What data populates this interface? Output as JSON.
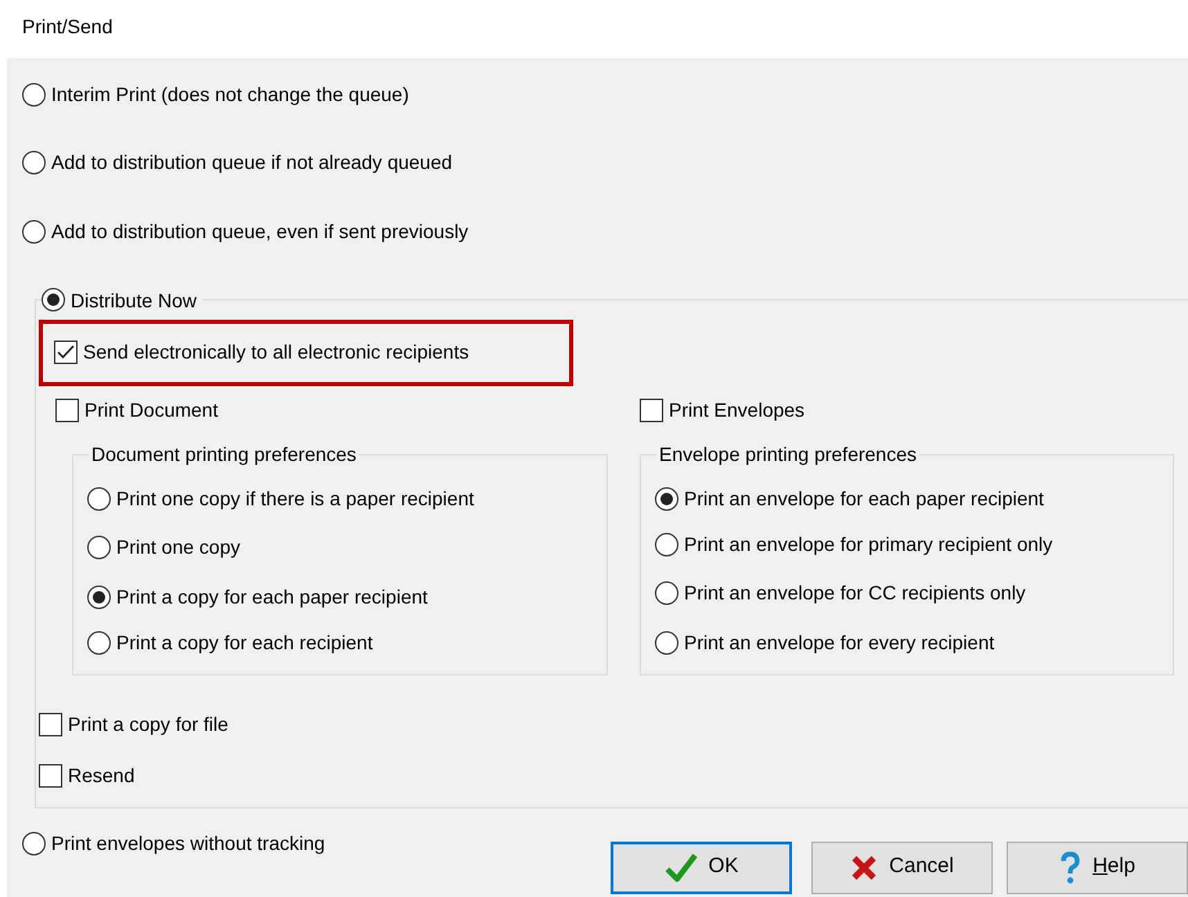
{
  "title": "Print/Send",
  "modes": [
    {
      "label": "Interim Print (does not change the queue)",
      "selected": false
    },
    {
      "label": "Add to distribution queue if not already queued",
      "selected": false
    },
    {
      "label": "Add to distribution queue, even if sent previously",
      "selected": false
    },
    {
      "label": "Distribute Now",
      "selected": true
    }
  ],
  "distribute": {
    "send_electronically": {
      "label": "Send electronically to all electronic recipients",
      "checked": true,
      "highlighted": true
    },
    "print_document": {
      "label": "Print Document",
      "checked": false
    },
    "print_envelopes": {
      "label": "Print Envelopes",
      "checked": false
    },
    "document_preferences": {
      "title": "Document printing preferences",
      "options": [
        {
          "label": "Print one copy if there is a paper recipient",
          "selected": false
        },
        {
          "label": "Print one copy",
          "selected": false
        },
        {
          "label": "Print a copy for each paper recipient",
          "selected": true
        },
        {
          "label": "Print a copy for each recipient",
          "selected": false
        }
      ]
    },
    "envelope_preferences": {
      "title": "Envelope printing preferences",
      "options": [
        {
          "label": "Print an envelope for each paper recipient",
          "selected": true
        },
        {
          "label": "Print an envelope for primary recipient only",
          "selected": false
        },
        {
          "label": "Print an envelope for CC recipients only",
          "selected": false
        },
        {
          "label": "Print an envelope for every recipient",
          "selected": false
        }
      ]
    },
    "print_copy_for_file": {
      "label": "Print a copy for file",
      "checked": false
    },
    "resend": {
      "label": "Resend",
      "checked": false
    }
  },
  "no_tracking": {
    "label": "Print envelopes without tracking",
    "selected": false
  },
  "buttons": [
    {
      "label": "OK",
      "kind": "ok",
      "default": true
    },
    {
      "label": "Cancel",
      "kind": "cancel",
      "default": false
    },
    {
      "label": "Help",
      "kind": "help",
      "default": false,
      "mnemonic_first": true
    }
  ]
}
